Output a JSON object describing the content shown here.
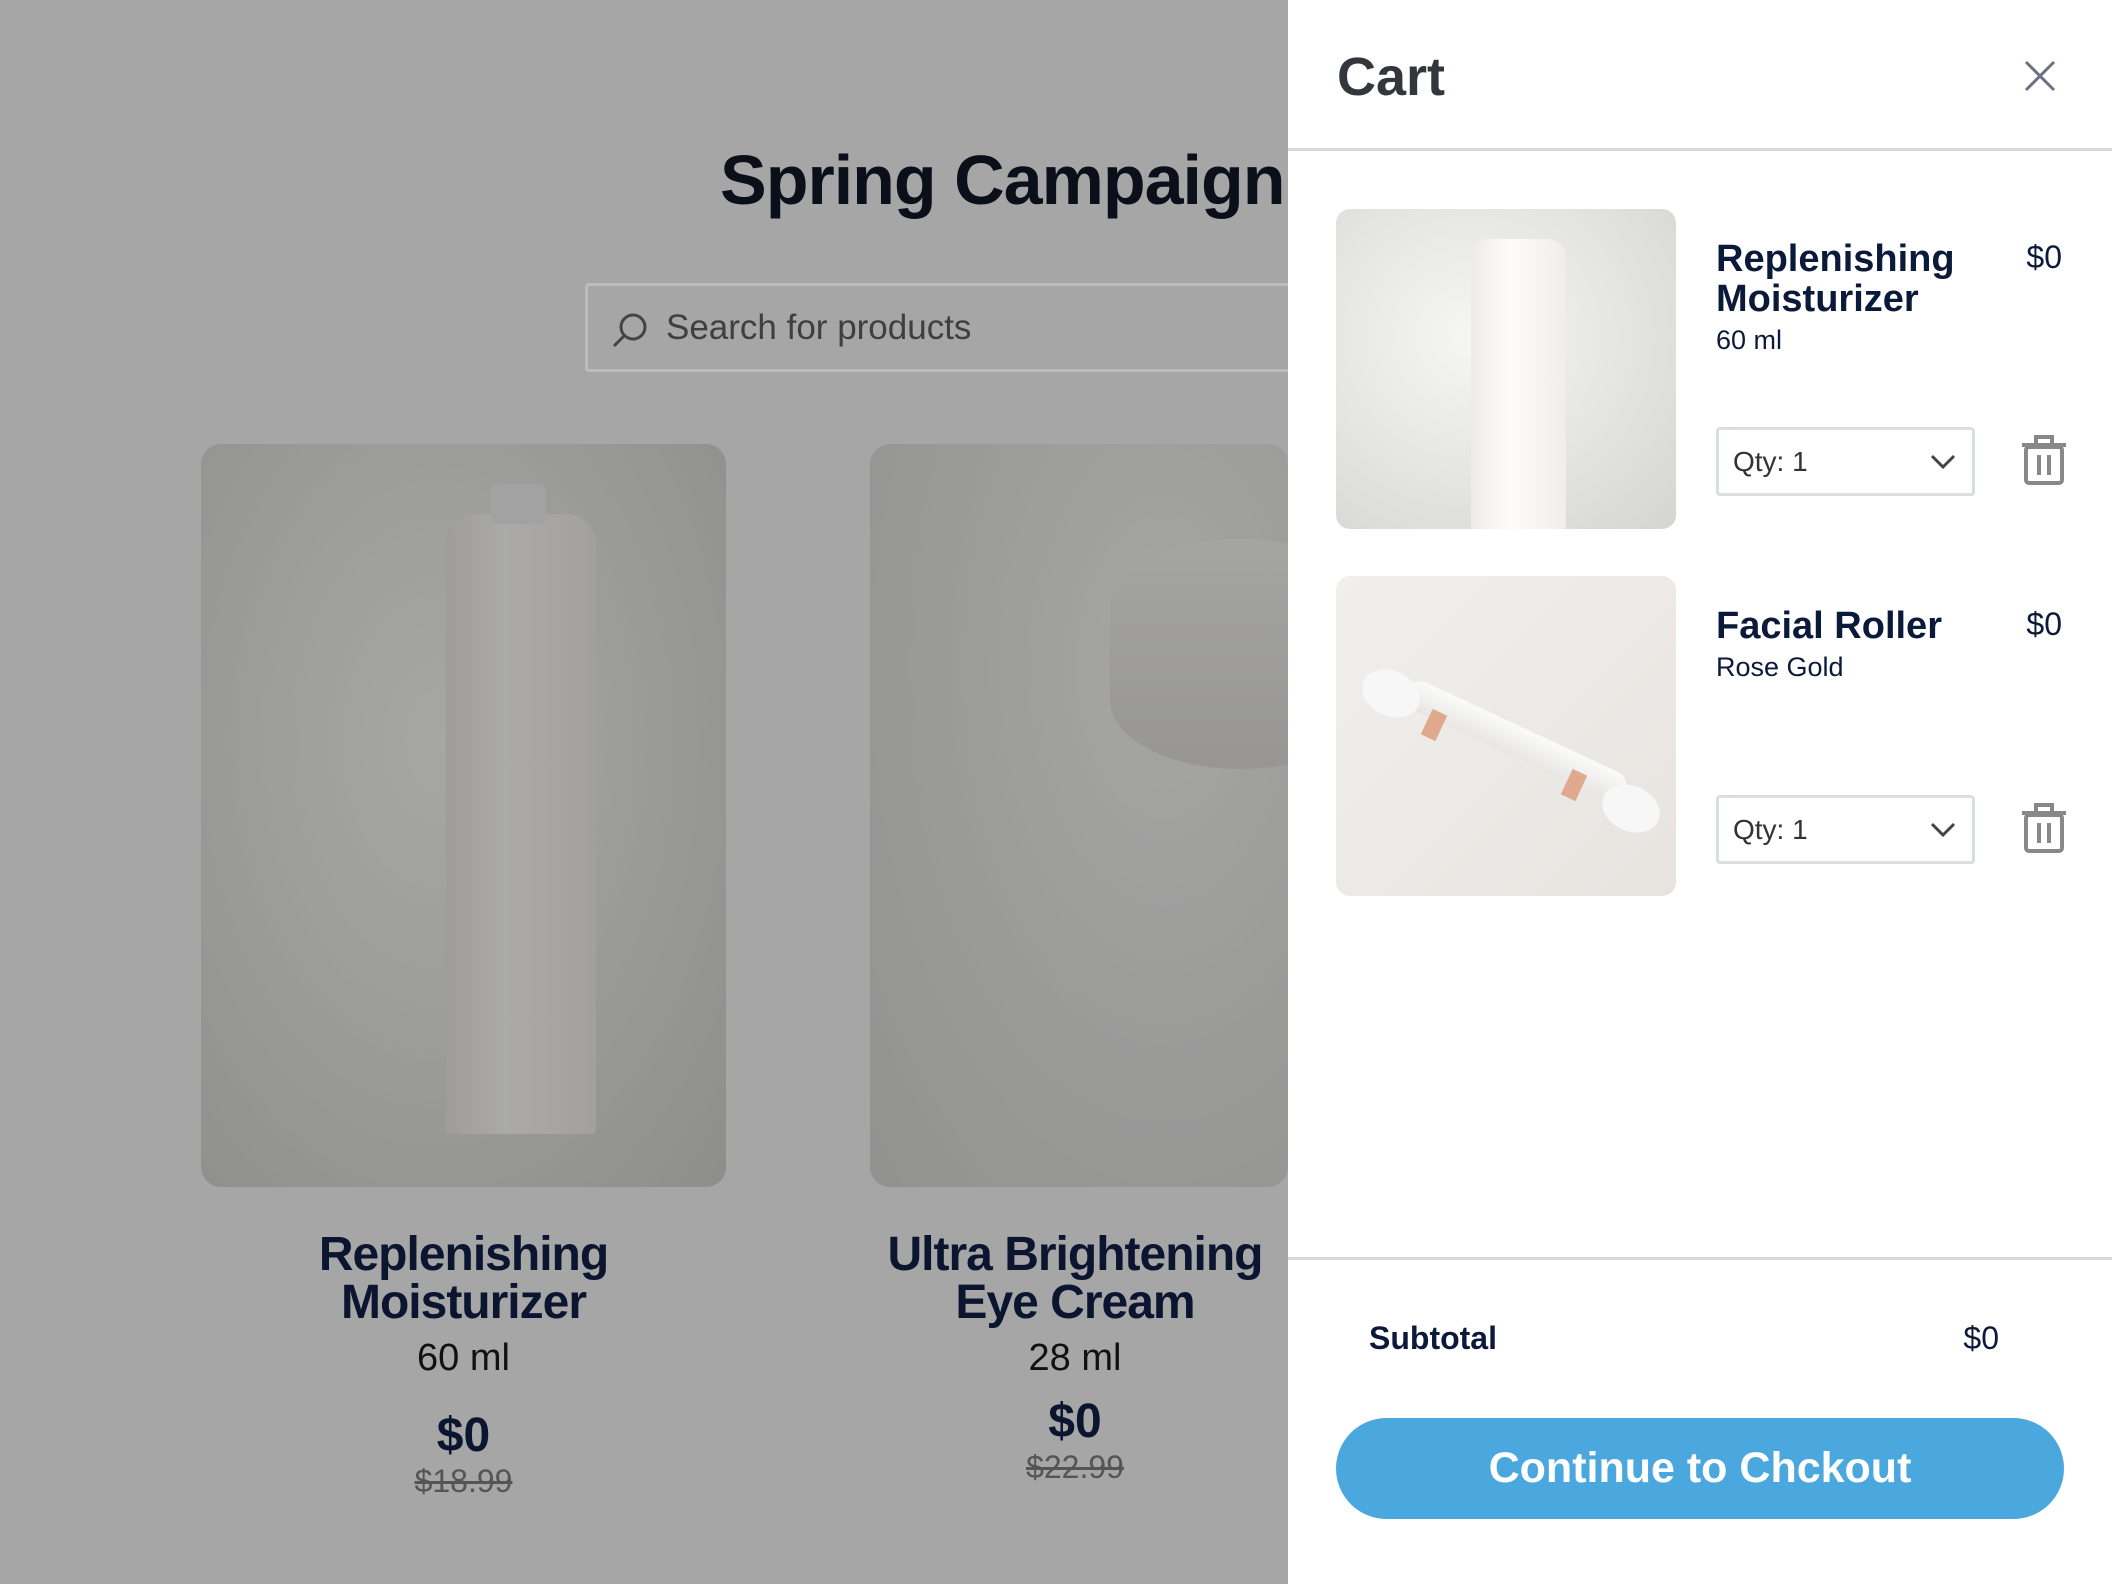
{
  "page": {
    "title": "Spring Campaign",
    "search_placeholder": "Search for products"
  },
  "products": [
    {
      "name": "Replenishing Moisturizer",
      "size": "60 ml",
      "price": "$0",
      "old_price": "$18.99"
    },
    {
      "name": "Ultra Brightening Eye Cream",
      "size": "28 ml",
      "price": "$0",
      "old_price": "$22.99"
    }
  ],
  "cart": {
    "title": "Cart",
    "items": [
      {
        "name": "Replenishing Moisturizer",
        "variant": "60 ml",
        "price": "$0",
        "qty": "Qty: 1"
      },
      {
        "name": "Facial Roller",
        "variant": "Rose Gold",
        "price": "$0",
        "qty": "Qty: 1"
      }
    ],
    "subtotal_label": "Subtotal",
    "subtotal_value": "$0",
    "checkout_label": "Continue to Chckout"
  },
  "colors": {
    "accent": "#4aa8de",
    "overlay": "#a6a6a6",
    "text": "#0b1a3a"
  }
}
